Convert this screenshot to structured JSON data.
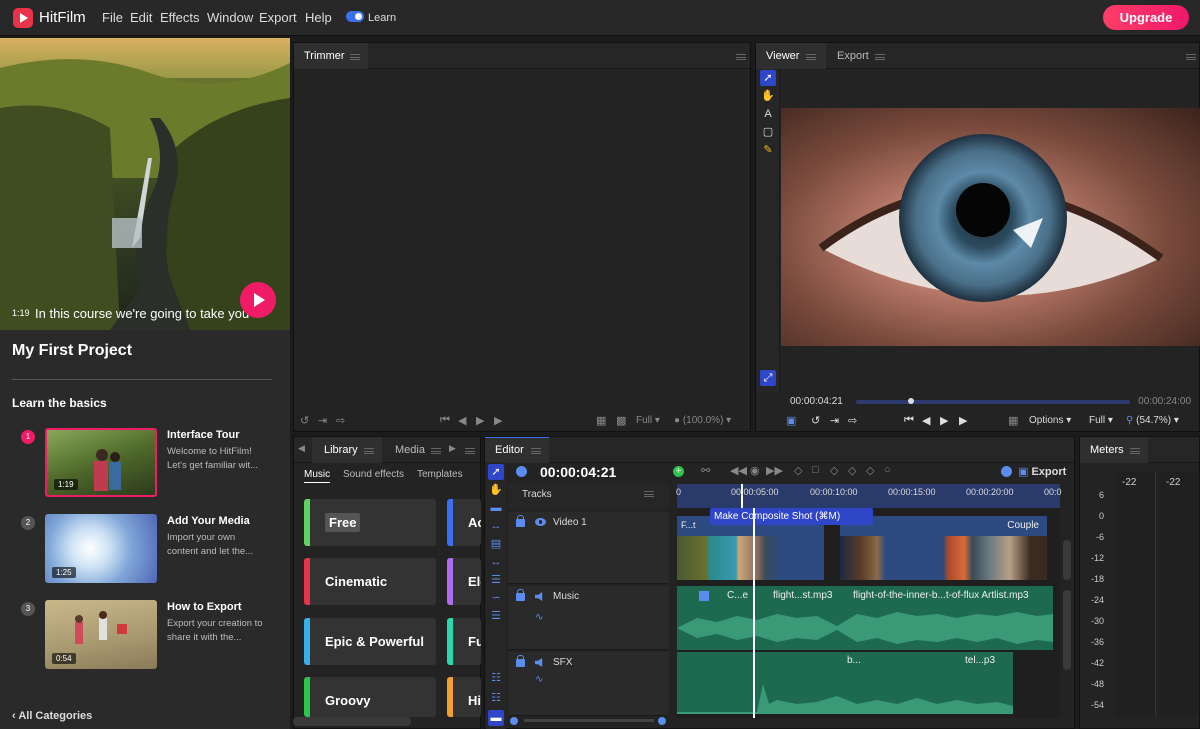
{
  "menubar": {
    "brand": "HitFilm",
    "items": [
      "File",
      "Edit",
      "Effects",
      "Window",
      "Export",
      "Help"
    ],
    "learn_label": "Learn",
    "upgrade_label": "Upgrade"
  },
  "learn": {
    "video_time": "1:19",
    "video_caption": "In this course we're going to take you",
    "project_title": "My First Project",
    "section_title": "Learn the basics",
    "lessons": [
      {
        "num": "1",
        "title": "Interface Tour",
        "desc": "Welcome to HitFilm! Let's get familiar wit...",
        "duration": "1:19"
      },
      {
        "num": "2",
        "title": "Add Your Media",
        "desc": "Import your own content and let the...",
        "duration": "1:25"
      },
      {
        "num": "3",
        "title": "How to Export",
        "desc": "Export your creation to share it with the...",
        "duration": "0:54"
      }
    ],
    "all_categories": "All Categories"
  },
  "trimmer": {
    "tab": "Trimmer",
    "quality": "Full",
    "zoom": "(100.0%)"
  },
  "viewer": {
    "tabs": [
      "Viewer",
      "Export"
    ],
    "time_current": "00:00:04:21",
    "time_total": "00:00:24:00",
    "playhead_fraction": 0.2,
    "options_label": "Options",
    "quality": "Full",
    "zoom": "(54.7%)"
  },
  "library": {
    "tabs": [
      "Library",
      "Media"
    ],
    "subtabs": [
      "Music",
      "Sound effects",
      "Templates"
    ],
    "categories": [
      {
        "label": "Free",
        "color": "#5fd35f"
      },
      {
        "label": "Cinematic",
        "color": "#e8334a"
      },
      {
        "label": "Epic & Powerful",
        "color": "#3ab0e8"
      },
      {
        "label": "Groovy",
        "color": "#2cc44a"
      }
    ],
    "categories_right": [
      {
        "label": "Ac",
        "color": "#3c6ff0"
      },
      {
        "label": "Ele",
        "color": "#b06cf0"
      },
      {
        "label": "Fu",
        "color": "#2ad8b0"
      },
      {
        "label": "Hi",
        "color": "#f0a030"
      }
    ]
  },
  "editor": {
    "tab": "Editor",
    "timecode": "00:00:04:21",
    "export_label": "Export",
    "tracks_label": "Tracks",
    "ruler": [
      "0",
      "00:00:05:00",
      "00:00:10:00",
      "00:00:15:00",
      "00:00:20:00",
      "00:0"
    ],
    "tooltip": "Make Composite Shot (⌘M)",
    "tracks": [
      {
        "name": "Video 1"
      },
      {
        "name": "Music"
      },
      {
        "name": "SFX"
      }
    ],
    "video_clips": [
      "F...t",
      "Couple"
    ],
    "music_clips": [
      "C...e",
      "flight...st.mp3",
      "flight-of-the-inner-b...t-of-flux Artlist.mp3"
    ],
    "sfx_clips": [
      "b...",
      "tel...p3"
    ]
  },
  "meters": {
    "tab": "Meters",
    "peaks": [
      "-22",
      "-22"
    ],
    "scale": [
      "6",
      "0",
      "-6",
      "-12",
      "-18",
      "-24",
      "-30",
      "-36",
      "-42",
      "-48",
      "-54"
    ]
  }
}
